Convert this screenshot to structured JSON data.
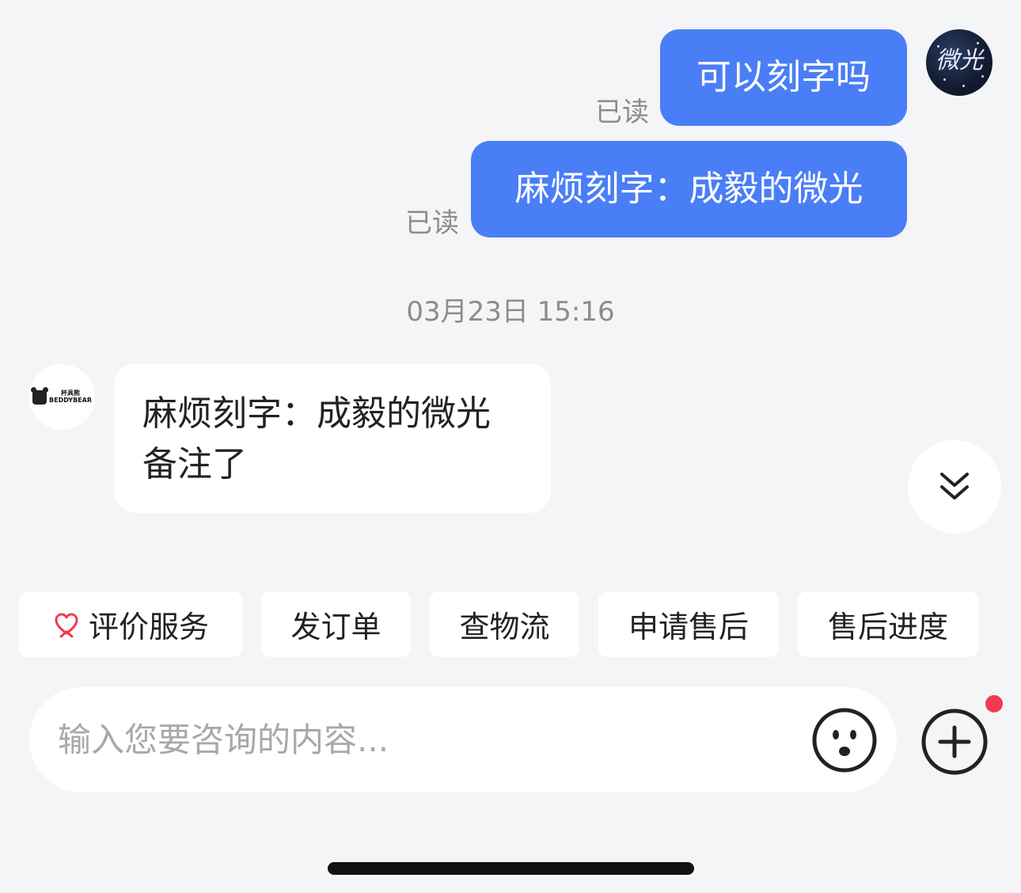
{
  "messages_out": [
    {
      "text": "可以刻字吗",
      "status": "已读"
    },
    {
      "text": "麻烦刻字：成毅的微光",
      "status": "已读"
    }
  ],
  "user_avatar": {
    "icon": "user-avatar-icon",
    "logo_text": "微光"
  },
  "timestamp": "03月23日 15:16",
  "shop_avatar": {
    "icon": "shop-avatar-icon",
    "brand_cn": "杯具熊",
    "brand_en": "BEDDYBEAR"
  },
  "message_in": {
    "line1": "麻烦刻字：成毅的微光",
    "line2": "备注了"
  },
  "scroll_button": {
    "icon": "double-chevron-down-icon"
  },
  "quick_actions": [
    {
      "label": "评价服务",
      "icon": "heart-hands-icon"
    },
    {
      "label": "发订单"
    },
    {
      "label": "查物流"
    },
    {
      "label": "申请售后"
    },
    {
      "label": "售后进度"
    }
  ],
  "input": {
    "placeholder": "输入您要咨询的内容..."
  },
  "colors": {
    "bubble_out": "#4a7ef7",
    "background": "#f4f5f7",
    "badge": "#f03b4e",
    "heart": "#f03b4e"
  }
}
